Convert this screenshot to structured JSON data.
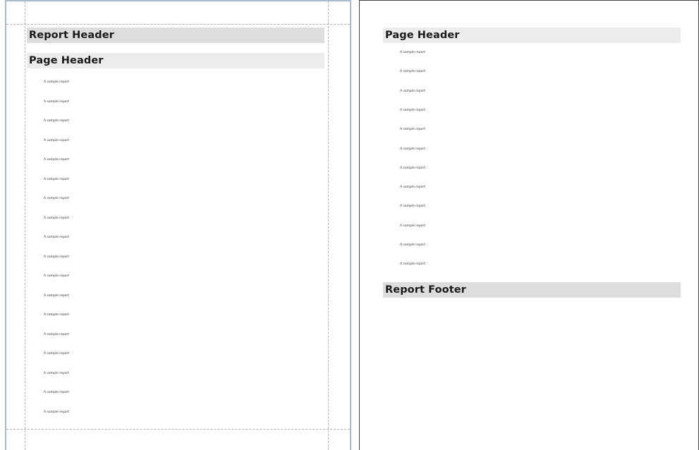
{
  "page1": {
    "report_header": "Report Header",
    "page_header": "Page Header",
    "items": [
      "A sample report",
      "A sample report",
      "A sample report",
      "A sample report",
      "A sample report",
      "A sample report",
      "A sample report",
      "A sample report",
      "A sample report",
      "A sample report",
      "A sample report",
      "A sample report",
      "A sample report",
      "A sample report",
      "A sample report",
      "A sample report",
      "A sample report",
      "A sample report"
    ]
  },
  "page2": {
    "page_header": "Page Header",
    "items": [
      "A sample report",
      "A sample report",
      "A sample report",
      "A sample report",
      "A sample report",
      "A sample report",
      "A sample report",
      "A sample report",
      "A sample report",
      "A sample report",
      "A sample report",
      "A sample report"
    ],
    "report_footer": "Report Footer"
  },
  "colors": {
    "band_dark": "#dddddd",
    "band_light": "#ececec",
    "selected_border": "#a9b9cf"
  }
}
